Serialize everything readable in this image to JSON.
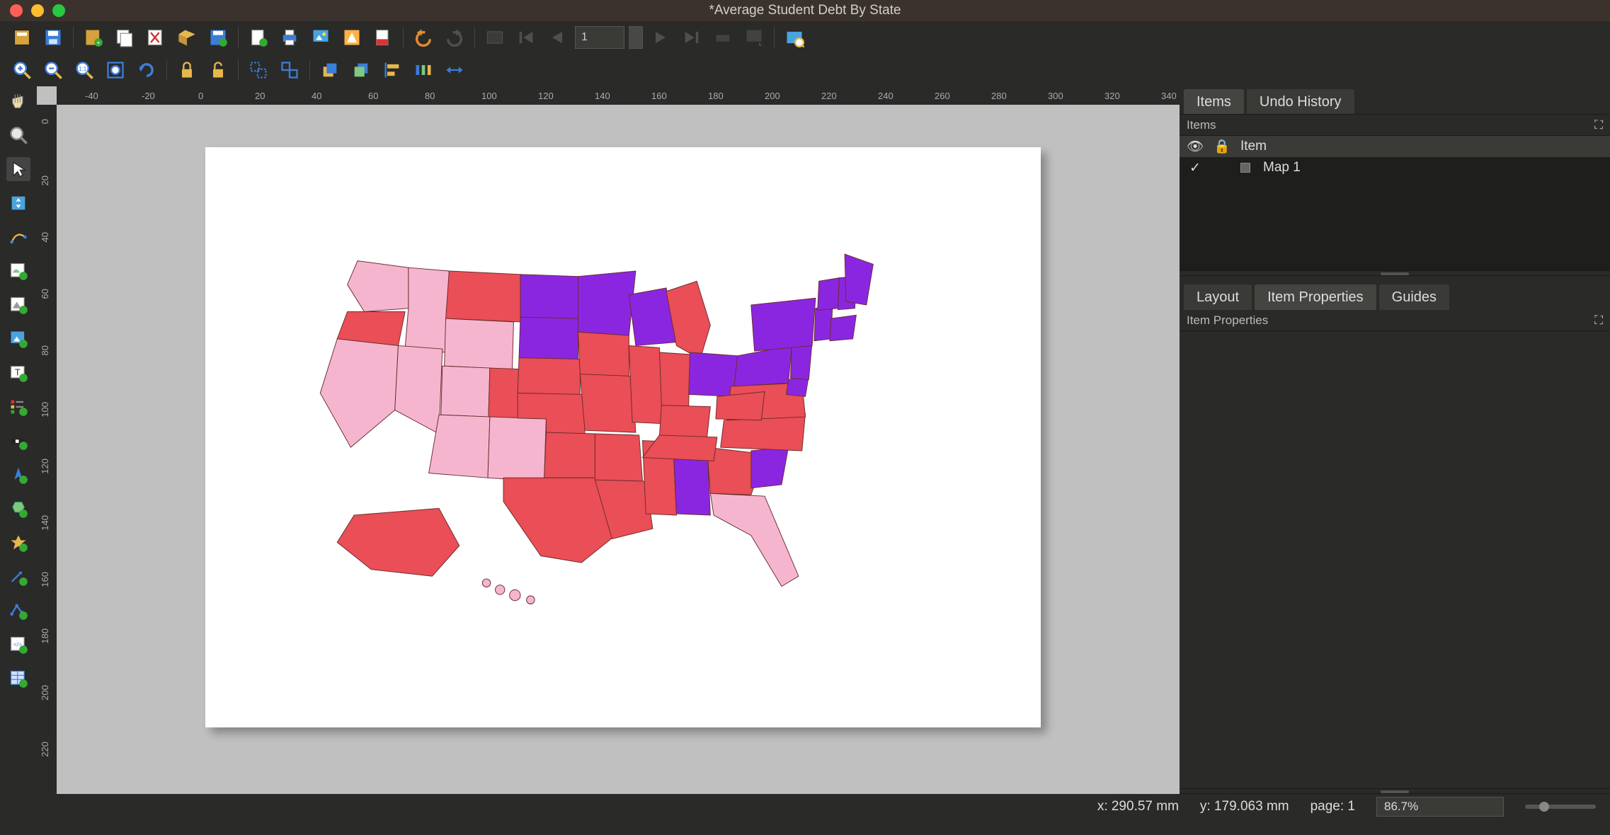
{
  "window": {
    "title": "*Average Student Debt By State"
  },
  "toolbar1": {
    "save_layout": "layout-icon",
    "save": "save-icon",
    "dup_layout": "duplicate-layout-icon",
    "delete_layout": "delete-layout-icon",
    "layout_manager": "layout-manager-icon",
    "open_folder": "folder-icon",
    "save_as": "save-as-icon",
    "add_items_folder": "add-items-folder-icon",
    "print": "print-icon",
    "export_image": "export-image-icon",
    "export_svg": "export-svg-icon",
    "export_pdf": "export-pdf-icon",
    "undo": "undo-icon",
    "redo": "redo-icon",
    "atlas_toggle": "atlas-toggle-icon",
    "atlas_first": "first-page-icon",
    "atlas_prev": "prev-page-icon",
    "page_value": "1",
    "atlas_next": "next-page-icon",
    "atlas_last": "last-page-icon",
    "atlas_print": "atlas-print-icon",
    "atlas_export_image": "atlas-export-image-icon",
    "atlas_settings": "atlas-settings-icon"
  },
  "toolbar2": {
    "zoom_in": "zoom-in-icon",
    "zoom_out": "zoom-out-icon",
    "zoom_100": "zoom-100-icon",
    "zoom_full": "zoom-full-icon",
    "refresh": "refresh-icon",
    "lock": "lock-items-icon",
    "unlock": "unlock-items-icon",
    "group": "group-icon",
    "ungroup": "ungroup-icon",
    "raise": "raise-icon",
    "lower": "lower-icon",
    "align": "align-icon",
    "distribute": "distribute-icon",
    "resize": "resize-icon"
  },
  "sidetools": [
    "pan-tool",
    "zoom-tool",
    "select-tool",
    "move-item-tool",
    "edit-nodes-tool",
    "add-map-tool",
    "add-3dmap-tool",
    "add-picture-tool",
    "add-label-tool",
    "add-legend-tool",
    "add-scalebar-tool",
    "add-north-arrow-tool",
    "add-shape-tool",
    "add-marker-tool",
    "add-arrow-tool",
    "add-nodes-tool",
    "add-html-tool",
    "add-attribute-table-tool"
  ],
  "ruler_h": [
    "-40",
    "-20",
    "0",
    "20",
    "40",
    "60",
    "80",
    "100",
    "120",
    "140",
    "160",
    "180",
    "200",
    "220",
    "240",
    "260",
    "280",
    "300",
    "320",
    "340"
  ],
  "ruler_v": [
    "0",
    "20",
    "40",
    "60",
    "80",
    "100",
    "120",
    "140",
    "160",
    "180",
    "200",
    "220"
  ],
  "rightpanel": {
    "tabs_top": {
      "items": "Items",
      "undo_history": "Undo History",
      "active": "items"
    },
    "items_header": "Items",
    "items_columns": {
      "item": "Item"
    },
    "items_list": [
      {
        "visible": true,
        "locked": false,
        "name": "Map 1"
      }
    ],
    "tabs_bottom": {
      "layout": "Layout",
      "item_properties": "Item Properties",
      "guides": "Guides",
      "active": "item_properties"
    },
    "properties_header": "Item Properties"
  },
  "status": {
    "x": "x: 290.57 mm",
    "y": "y: 179.063 mm",
    "page": "page: 1",
    "zoom": "86.7%"
  },
  "map": {
    "colors": {
      "low": "#f6b5cf",
      "mid": "#ea4e56",
      "high": "#8b26e0",
      "stroke": "#6a2c2c"
    },
    "legend_note": "choropleth of US states colored by debt level"
  }
}
